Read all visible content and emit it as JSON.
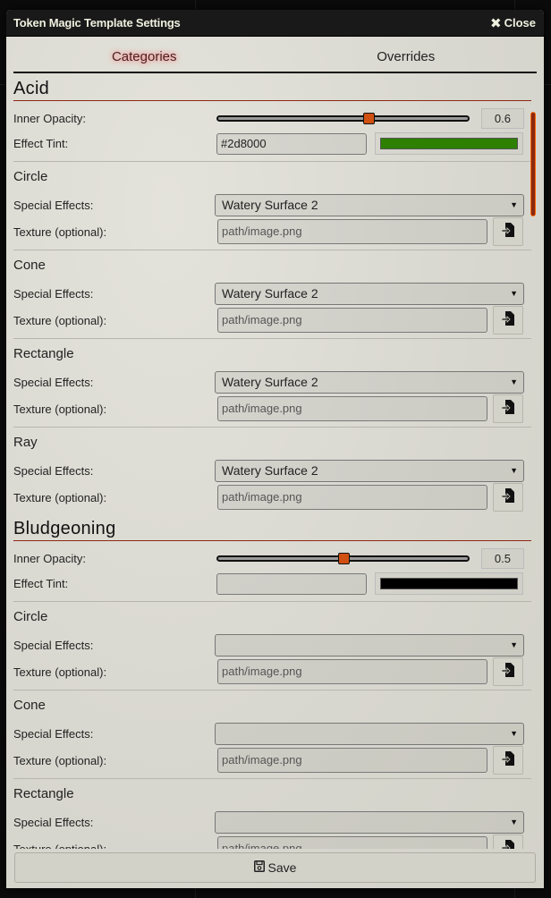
{
  "window": {
    "title": "Token Magic Template Settings",
    "close_label": "Close"
  },
  "tabs": [
    {
      "label": "Categories",
      "active": true
    },
    {
      "label": "Overrides",
      "active": false
    }
  ],
  "labels": {
    "inner_opacity": "Inner Opacity:",
    "effect_tint": "Effect Tint:",
    "special_effects": "Special Effects:",
    "texture": "Texture (optional):"
  },
  "categories": [
    {
      "name": "Acid",
      "inner_opacity": 0.6,
      "inner_opacity_display": "0.6",
      "inner_opacity_range": [
        0,
        1
      ],
      "effect_tint": "#2d8000",
      "swatch_color": "#2d8000",
      "shapes": [
        {
          "name": "Circle",
          "special_effect": "Watery Surface 2",
          "texture_placeholder": "path/image.png"
        },
        {
          "name": "Cone",
          "special_effect": "Watery Surface 2",
          "texture_placeholder": "path/image.png"
        },
        {
          "name": "Rectangle",
          "special_effect": "Watery Surface 2",
          "texture_placeholder": "path/image.png"
        },
        {
          "name": "Ray",
          "special_effect": "Watery Surface 2",
          "texture_placeholder": "path/image.png"
        }
      ]
    },
    {
      "name": "Bludgeoning",
      "inner_opacity": 0.5,
      "inner_opacity_display": "0.5",
      "inner_opacity_range": [
        0,
        1
      ],
      "effect_tint": "",
      "swatch_color": "#000000",
      "shapes": [
        {
          "name": "Circle",
          "special_effect": "",
          "texture_placeholder": "path/image.png"
        },
        {
          "name": "Cone",
          "special_effect": "",
          "texture_placeholder": "path/image.png"
        },
        {
          "name": "Rectangle",
          "special_effect": "",
          "texture_placeholder": "path/image.png"
        }
      ]
    }
  ],
  "footer": {
    "save_label": "Save"
  },
  "colors": {
    "accent": "#d05012",
    "header_rule": "#8a2a12"
  }
}
